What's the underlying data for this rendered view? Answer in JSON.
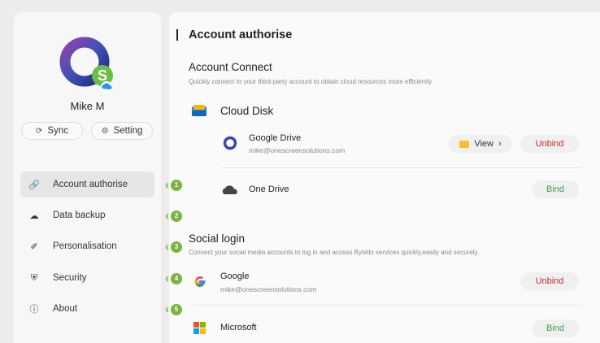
{
  "profile": {
    "name": "Mike M"
  },
  "buttons": {
    "sync": "Sync",
    "setting": "Setting"
  },
  "nav": [
    {
      "label": "Account authorise",
      "icon": "link-icon",
      "active": true
    },
    {
      "label": "Data backup",
      "icon": "cloud-upload-icon",
      "active": false
    },
    {
      "label": "Personalisation",
      "icon": "brush-icon",
      "active": false
    },
    {
      "label": "Security",
      "icon": "shield-icon",
      "active": false
    },
    {
      "label": "About",
      "icon": "info-icon",
      "active": false
    }
  ],
  "steps": [
    "1",
    "2",
    "3",
    "4",
    "5"
  ],
  "page_title": "Account authorise",
  "account_connect": {
    "title": "Account Connect",
    "description": "Quickly connect to your third-party account to obtain cloud resources more efficiently",
    "cloud_disk_title": "Cloud Disk",
    "services": [
      {
        "name": "Google Drive",
        "email": "mike@onescreensolutions.com",
        "view_label": "View",
        "action": "Unbind"
      },
      {
        "name": "One Drive",
        "action": "Bind"
      }
    ]
  },
  "social_login": {
    "title": "Social login",
    "description": "Connect your social media accounts to log in and access Bytello services quickly,easily and securely.",
    "services": [
      {
        "name": "Google",
        "email": "mike@onescreensolutions.com",
        "action": "Unbind"
      },
      {
        "name": "Microsoft",
        "action": "Bind"
      }
    ]
  },
  "colors": {
    "accent_green": "#7cb342",
    "unbind_red": "#c62828",
    "bind_green": "#43a047"
  }
}
